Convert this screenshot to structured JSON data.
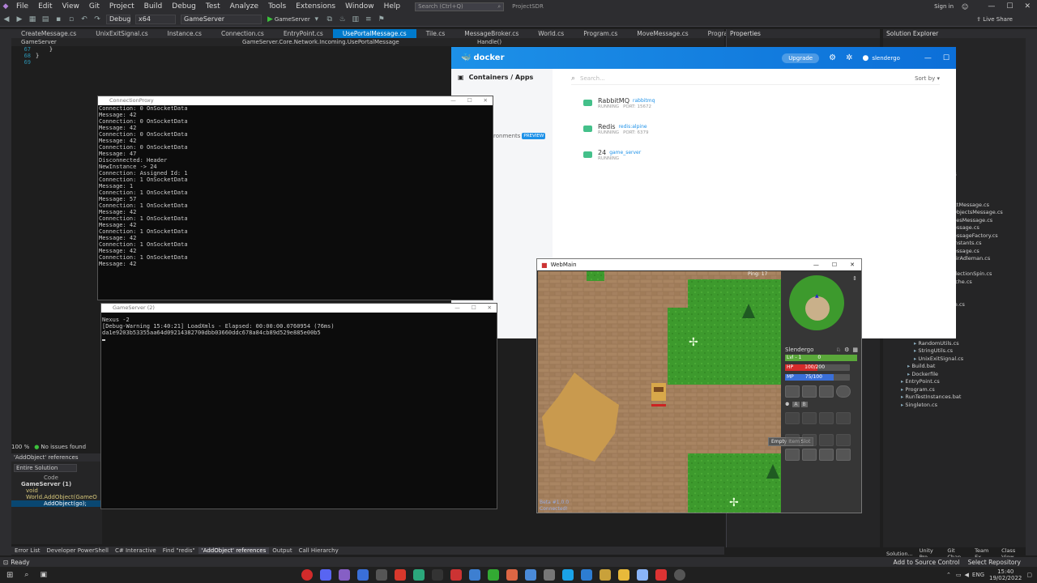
{
  "menu": [
    "File",
    "Edit",
    "View",
    "Git",
    "Project",
    "Build",
    "Debug",
    "Test",
    "Analyze",
    "Tools",
    "Extensions",
    "Window",
    "Help"
  ],
  "search_placeholder": "Search (Ctrl+Q)",
  "solution_name": "ProjectSDR",
  "sign_in": "Sign in",
  "live_share": "Live Share",
  "toolbar": {
    "config": "Debug",
    "platform": "x64",
    "startup": "GameServer",
    "run_label": "GameServer"
  },
  "tabs": [
    "CreateMessage.cs",
    "UnixExitSignal.cs",
    "Instance.cs",
    "Connection.cs",
    "EntryPoint.cs",
    "UsePortalMessage.cs",
    "Tile.cs",
    "MessageBroker.cs",
    "World.cs",
    "Program.cs",
    "MoveMessage.cs",
    "Program.cs",
    "UpdateTilesMessage.cs"
  ],
  "active_tab_index": 5,
  "navbar": {
    "project": "GameServer",
    "path": "GameServer.Core.Network.Incoming.UsePortalMessage",
    "member": "Handle()"
  },
  "editor_lines": [
    {
      "num": "67",
      "code": "    }"
    },
    {
      "num": "68",
      "code": "}"
    },
    {
      "num": "69",
      "code": ""
    }
  ],
  "properties_title": "Properties",
  "solution_title": "Solution Explorer",
  "solution_items": [
    {
      "indent": 0,
      "label": "er.cs"
    },
    {
      "indent": 0,
      "label": "ect.cs"
    },
    {
      "indent": 0,
      "label": "ect.cs"
    },
    {
      "indent": 0,
      "label": "ffect.cs"
    },
    {
      "indent": 0,
      "label": "e.cs"
    },
    {
      "indent": 0,
      "label": "s"
    },
    {
      "indent": 0,
      "label": "Data.cs"
    },
    {
      "indent": 0,
      "label": "ssage.cs"
    },
    {
      "indent": 0,
      "label": "ge.cs"
    },
    {
      "indent": 0,
      "label": "ge.cs"
    },
    {
      "indent": 0,
      "label": "Message.cs"
    },
    {
      "indent": 0,
      "label": "ctsMessage.cs"
    },
    {
      "indent": 0,
      "label": "Message.cs"
    },
    {
      "indent": 0,
      "label": "ccessMessage.cs"
    },
    {
      "indent": 0,
      "label": "sage.cs"
    },
    {
      "indent": 0,
      "label": "sage.cs"
    },
    {
      "indent": 0,
      "label": "essage.cs"
    },
    {
      "indent": 3,
      "label": "ReconnectMessage.cs"
    },
    {
      "indent": 3,
      "label": "RemoveObjectsMessage.cs"
    },
    {
      "indent": 3,
      "label": "UpdateTilesMessage.cs"
    },
    {
      "indent": 2,
      "label": "IncomingMessage.cs"
    },
    {
      "indent": 2,
      "label": "IncomingMessageFactory.cs"
    },
    {
      "indent": 2,
      "label": "MessageConstants.cs"
    },
    {
      "indent": 2,
      "label": "OutgoingMessage.cs"
    },
    {
      "indent": 2,
      "label": "RivestShamirAdleman.cs"
    },
    {
      "indent": 1,
      "label": "Structures"
    },
    {
      "indent": 2,
      "label": "BlockingCollectionSpin.cs"
    },
    {
      "indent": 2,
      "label": "MapDataCache.cs"
    },
    {
      "indent": 0,
      "label": "Database"
    },
    {
      "indent": 1,
      "label": "Models"
    },
    {
      "indent": 1,
      "label": "RedisDatabase.cs"
    },
    {
      "indent": 0,
      "label": "Utilities"
    },
    {
      "indent": 1,
      "label": "debugging"
    },
    {
      "indent": 1,
      "label": "xml"
    },
    {
      "indent": 1,
      "label": "ArrayUtils.cs"
    },
    {
      "indent": 1,
      "label": "RandomUtils.cs"
    },
    {
      "indent": 1,
      "label": "StringUtils.cs"
    },
    {
      "indent": 1,
      "label": "UnixExitSignal.cs"
    },
    {
      "indent": 0,
      "label": "Build.bat"
    },
    {
      "indent": 0,
      "label": "Dockerfile"
    },
    {
      "indent": -1,
      "label": "EntryPoint.cs"
    },
    {
      "indent": -1,
      "label": "Program.cs"
    },
    {
      "indent": -1,
      "label": "RunTestInstances.bat"
    },
    {
      "indent": -1,
      "label": "Singleton.cs"
    }
  ],
  "solution_bottom_tabs": [
    "Solution...",
    "Unity Pro...",
    "Git Chan...",
    "Team Ex...",
    "Class View"
  ],
  "editor_status": {
    "zoom": "100 %",
    "issues": "No issues found"
  },
  "refs_panel": {
    "title": "'AddObject' references",
    "scope": "Entire Solution",
    "col": "Code",
    "group": "GameServer (1)",
    "item": "void World.AddObject(GameO",
    "sub": "AddObject(go);"
  },
  "bottom_tabs": [
    "Error List",
    "Developer PowerShell",
    "C# Interactive",
    "Find \"redis\"",
    "'AddObject' references",
    "Output",
    "Call Hierarchy"
  ],
  "status": {
    "ready": "Ready",
    "add_source": "Add to Source Control",
    "select_repo": "Select Repository"
  },
  "taskbar": {
    "lang": "ENG",
    "time": "15:40",
    "date": "19/02/2022"
  },
  "docker": {
    "logo": "docker",
    "upgrade": "Upgrade",
    "user": "slendergo",
    "nav_title": "Containers / Apps",
    "nav_env": "ronments",
    "preview_badge": "PREVIEW",
    "search_placeholder": "Search...",
    "sort": "Sort by",
    "containers": [
      {
        "name": "RabbitMQ",
        "image": "rabbitmq",
        "status": "RUNNING",
        "port": "PORT: 15672"
      },
      {
        "name": "Redis",
        "image": "redis:alpine",
        "status": "RUNNING",
        "port": "PORT: 6379"
      },
      {
        "name": "24",
        "image": "game_server",
        "status": "RUNNING",
        "port": ""
      }
    ]
  },
  "proxy_window": {
    "title": "ConnectionProxy",
    "lines": [
      "Connection: 0 OnSocketData",
      "Message: 42",
      "Connection: 0 OnSocketData",
      "Message: 42",
      "Connection: 0 OnSocketData",
      "Message: 42",
      "Connection: 0 OnSocketData",
      "Message: 47",
      "Disconnected: Header",
      "NewInstance -> 24",
      "Connection: Assigned Id: 1",
      "Connection: 1 OnSocketData",
      "Message: 1",
      "Connection: 1 OnSocketData",
      "Message: 57",
      "Connection: 1 OnSocketData",
      "Message: 42",
      "Connection: 1 OnSocketData",
      "Message: 42",
      "Connection: 1 OnSocketData",
      "Message: 42",
      "Connection: 1 OnSocketData",
      "Message: 42",
      "Connection: 1 OnSocketData",
      "Message: 42"
    ]
  },
  "server_window": {
    "title": "GameServer (2)",
    "lines": [
      "Nexus -2",
      "[Debug-Warning 15:40:21] LoadXmls - Elapsed: 00:00:00.0760954 (76ms)",
      "da1e9203b53355aa64d09214382700dbb03660ddc678a84cb89d529e885e00b5"
    ]
  },
  "webmain": {
    "title": "WebMain",
    "ping": "Ping: 17",
    "player_name": "Slendergo",
    "level": "Lvl - 1",
    "xp": "0",
    "hp_label": "HP",
    "hp": "100/200",
    "hp_fraction": 0.5,
    "mp_label": "MP",
    "mp": "75/100",
    "mp_fraction": 0.75,
    "tooltip": "Empty Item Slot",
    "version": "Beta #1.0.0",
    "connected": "Connected!"
  },
  "colors": {
    "accent": "#007acc",
    "docker_blue": "#1d91e8",
    "running_green": "#44c08a",
    "hp_red": "#d62b2b",
    "mp_blue": "#3a6fd8",
    "xp_green": "#5aa83a",
    "grass": "#3c9a2c",
    "dirt": "#9c7a54"
  }
}
